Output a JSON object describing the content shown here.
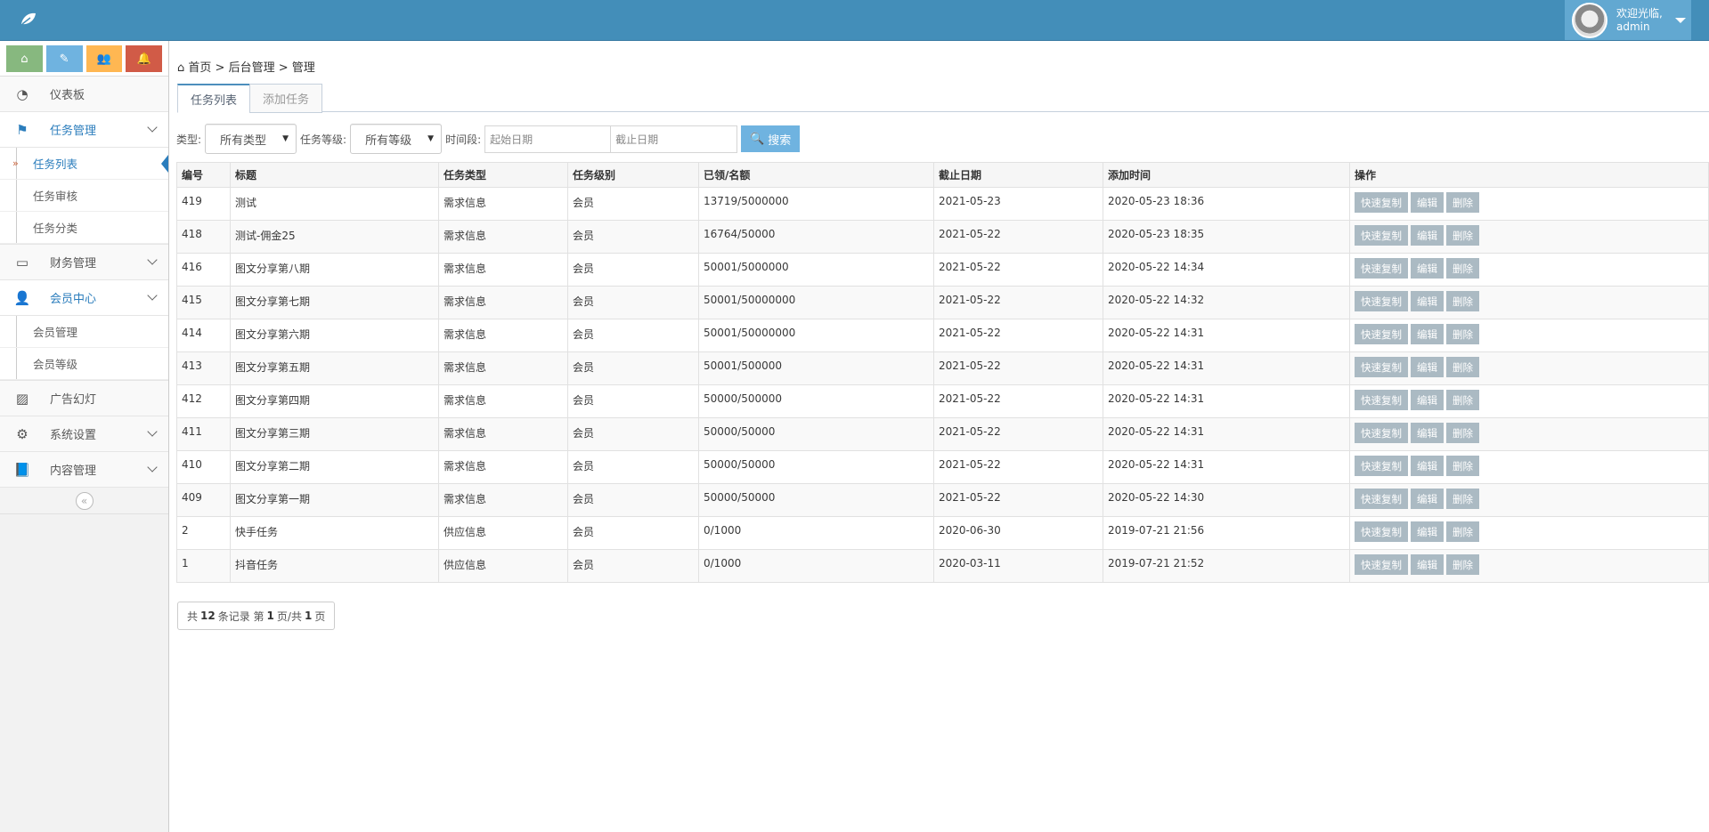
{
  "header": {
    "welcome": "欢迎光临,",
    "username": "admin"
  },
  "sidebar": {
    "items": [
      {
        "label": "仪表板",
        "icon": "dashboard-icon"
      },
      {
        "label": "任务管理",
        "icon": "flag-icon",
        "children": [
          "任务列表",
          "任务审核",
          "任务分类"
        ]
      },
      {
        "label": "财务管理",
        "icon": "inbox-icon"
      },
      {
        "label": "会员中心",
        "icon": "user-icon",
        "children": [
          "会员管理",
          "会员等级"
        ]
      },
      {
        "label": "广告幻灯",
        "icon": "picture-icon"
      },
      {
        "label": "系统设置",
        "icon": "gear-icon"
      },
      {
        "label": "内容管理",
        "icon": "book-icon"
      }
    ]
  },
  "breadcrumb": [
    "首页",
    "后台管理",
    "管理"
  ],
  "tabs": [
    "任务列表",
    "添加任务"
  ],
  "filters": {
    "type_label": "类型:",
    "type_value": "所有类型",
    "level_label": "任务等级:",
    "level_value": "所有等级",
    "period_label": "时间段:",
    "start_placeholder": "起始日期",
    "end_placeholder": "截止日期",
    "search": "搜索"
  },
  "table": {
    "headers": [
      "编号",
      "标题",
      "任务类型",
      "任务级别",
      "已领/名额",
      "截止日期",
      "添加时间",
      "操作"
    ],
    "actions": [
      "快速复制",
      "编辑",
      "删除"
    ],
    "rows": [
      [
        "419",
        "测试",
        "需求信息",
        "会员",
        "13719/5000000",
        "2021-05-23",
        "2020-05-23 18:36"
      ],
      [
        "418",
        "测试-佣金25",
        "需求信息",
        "会员",
        "16764/50000",
        "2021-05-22",
        "2020-05-23 18:35"
      ],
      [
        "416",
        "图文分享第八期",
        "需求信息",
        "会员",
        "50001/5000000",
        "2021-05-22",
        "2020-05-22 14:34"
      ],
      [
        "415",
        "图文分享第七期",
        "需求信息",
        "会员",
        "50001/50000000",
        "2021-05-22",
        "2020-05-22 14:32"
      ],
      [
        "414",
        "图文分享第六期",
        "需求信息",
        "会员",
        "50001/50000000",
        "2021-05-22",
        "2020-05-22 14:31"
      ],
      [
        "413",
        "图文分享第五期",
        "需求信息",
        "会员",
        "50001/500000",
        "2021-05-22",
        "2020-05-22 14:31"
      ],
      [
        "412",
        "图文分享第四期",
        "需求信息",
        "会员",
        "50000/500000",
        "2021-05-22",
        "2020-05-22 14:31"
      ],
      [
        "411",
        "图文分享第三期",
        "需求信息",
        "会员",
        "50000/50000",
        "2021-05-22",
        "2020-05-22 14:31"
      ],
      [
        "410",
        "图文分享第二期",
        "需求信息",
        "会员",
        "50000/50000",
        "2021-05-22",
        "2020-05-22 14:31"
      ],
      [
        "409",
        "图文分享第一期",
        "需求信息",
        "会员",
        "50000/50000",
        "2021-05-22",
        "2020-05-22 14:30"
      ],
      [
        "2",
        "快手任务",
        "供应信息",
        "会员",
        "0/1000",
        "2020-06-30",
        "2019-07-21 21:56"
      ],
      [
        "1",
        "抖音任务",
        "供应信息",
        "会员",
        "0/1000",
        "2020-03-11",
        "2019-07-21 21:52"
      ]
    ]
  },
  "pager": {
    "p1": "共",
    "total": "12",
    "p2": "条记录 第",
    "page": "1",
    "p3": "页/共",
    "pages": "1",
    "p4": "页"
  },
  "colors": {
    "header": "#438eb9",
    "accent": "#2b7dbc",
    "op_button": "#abbac3"
  }
}
